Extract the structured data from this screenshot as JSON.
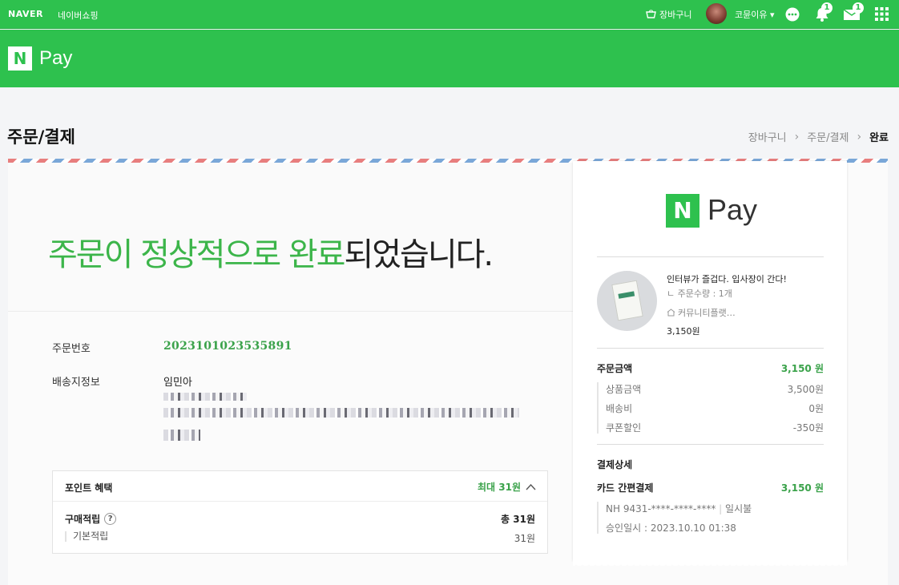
{
  "gnb": {
    "brand": "NAVER",
    "shopping": "네이버쇼핑",
    "cart": "장바구니",
    "user": "코뮨이유",
    "talk_badge": "",
    "alarm_badge": "1",
    "mail_badge": "1"
  },
  "pay_header": {
    "n": "N",
    "pay": "Pay"
  },
  "page": {
    "title": "주문/결제",
    "breadcrumb": [
      "장바구니",
      "주문/결제",
      "완료"
    ]
  },
  "complete": {
    "headline_green": "주문이 정상적으로 완료",
    "headline_rest": "되었습니다."
  },
  "order": {
    "number_label": "주문번호",
    "number": "2023101023535891",
    "shipping_label": "배송지정보",
    "recipient": "임민아"
  },
  "points": {
    "title": "포인트 혜택",
    "max": "최대 31원",
    "purchase_label": "구매적립",
    "purchase_total": "총 31원",
    "basic_label": "기본적립",
    "basic_value": "31원"
  },
  "receipt": {
    "logo_n": "N",
    "logo_pay": "Pay",
    "product": {
      "title": "인터뷰가 즐겁다. 입사장이 간다!",
      "qty": "ㄴ 주문수량 : 1개",
      "shop": "커뮤니티플랫…",
      "price": "3,150원"
    },
    "order_amount_label": "주문금액",
    "order_amount": "3,150 원",
    "product_amount_label": "상품금액",
    "product_amount": "3,500원",
    "shipping_label": "배송비",
    "shipping": "0원",
    "coupon_label": "쿠폰할인",
    "coupon": "-350원",
    "payment_detail_label": "결제상세",
    "card_label": "카드 간편결제",
    "card_amount": "3,150 원",
    "card_number": "NH 9431-****-****-****",
    "installment": "일시불",
    "approval": "승인일시 : 2023.10.10 01:38"
  },
  "colors": {
    "brand": "#2ec14e",
    "accent_text": "#3aa24a"
  }
}
